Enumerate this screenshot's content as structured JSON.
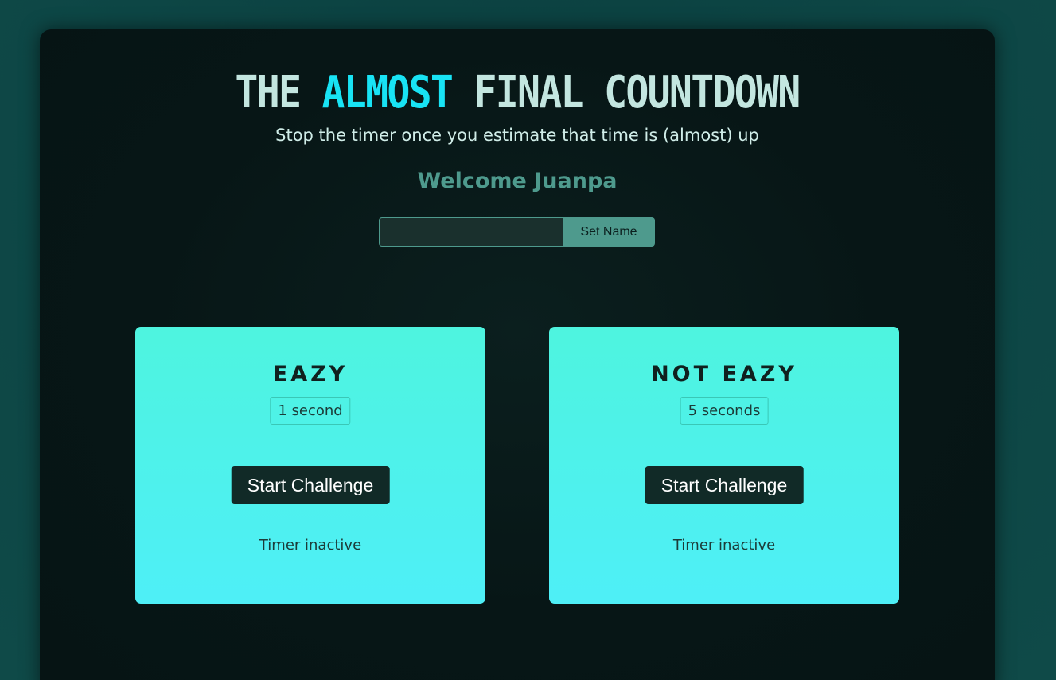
{
  "header": {
    "title_part1": "THE ",
    "title_highlight": "ALMOST",
    "title_part2": " FINAL COUNTDOWN",
    "subtitle": "Stop the timer once you estimate that time is (almost) up",
    "welcome": "Welcome Juanpa"
  },
  "name_form": {
    "input_value": "",
    "button_label": "Set Name"
  },
  "challenges": [
    {
      "title": "EAZY",
      "duration": "1 second",
      "button_label": "Start Challenge",
      "status": "Timer inactive"
    },
    {
      "title": "NOT EAZY",
      "duration": "5 seconds",
      "button_label": "Start Challenge",
      "status": "Timer inactive"
    }
  ],
  "colors": {
    "accent": "#18e3f4",
    "card": "#4ef4df",
    "button": "#112a27",
    "muted_teal": "#4e9a8d"
  }
}
